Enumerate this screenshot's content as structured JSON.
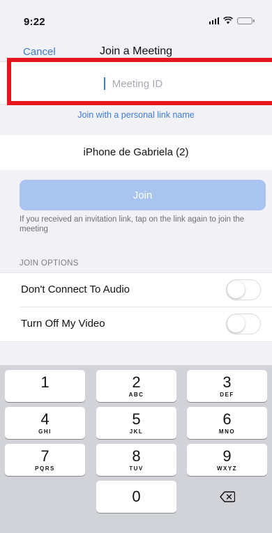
{
  "status_bar": {
    "time": "9:22"
  },
  "nav": {
    "cancel_label": "Cancel",
    "title": "Join a Meeting"
  },
  "meeting_id": {
    "placeholder": "Meeting ID",
    "value": ""
  },
  "personal_link_label": "Join with a personal link name",
  "device_name": "iPhone de Gabriela (2)",
  "join_button_label": "Join",
  "join_hint": "If you received an invitation link, tap on the link again to join the meeting",
  "join_options": {
    "header": "JOIN OPTIONS",
    "items": [
      {
        "label": "Don't Connect To Audio",
        "enabled": false
      },
      {
        "label": "Turn Off My Video",
        "enabled": false
      }
    ]
  },
  "keypad": {
    "keys": [
      {
        "digit": "1",
        "letters": ""
      },
      {
        "digit": "2",
        "letters": "ABC"
      },
      {
        "digit": "3",
        "letters": "DEF"
      },
      {
        "digit": "4",
        "letters": "GHI"
      },
      {
        "digit": "5",
        "letters": "JKL"
      },
      {
        "digit": "6",
        "letters": "MNO"
      },
      {
        "digit": "7",
        "letters": "PQRS"
      },
      {
        "digit": "8",
        "letters": "TUV"
      },
      {
        "digit": "9",
        "letters": "WXYZ"
      },
      {
        "digit": "0",
        "letters": ""
      }
    ],
    "delete_icon": "backspace-icon"
  },
  "colors": {
    "accent": "#3a7bd5",
    "join_button": "#a9c4ee",
    "highlight": "#e5161d"
  }
}
